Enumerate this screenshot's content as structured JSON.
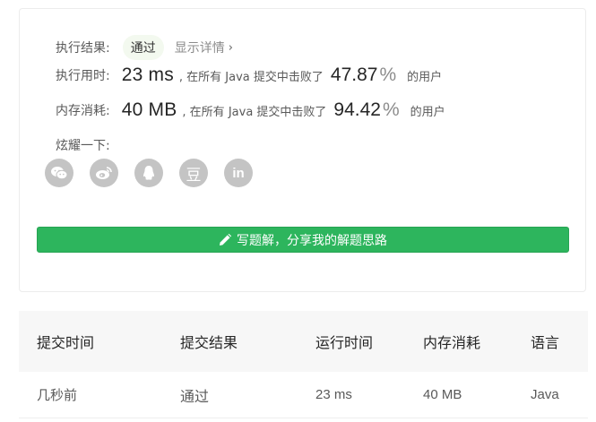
{
  "result": {
    "label": "执行结果:",
    "status": "通过",
    "detail_link": "显示详情",
    "detail_chevron": "›"
  },
  "runtime": {
    "label": "执行用时:",
    "value": "23 ms",
    "prefix": ", 在所有 Java 提交中击败了",
    "percent": "47.87",
    "percent_sign": "%",
    "suffix": "的用户"
  },
  "memory": {
    "label": "内存消耗:",
    "value": "40 MB",
    "prefix": ", 在所有 Java 提交中击败了",
    "percent": "94.42",
    "percent_sign": "%",
    "suffix": "的用户"
  },
  "share": {
    "title": "炫耀一下:",
    "icons": [
      "wechat-icon",
      "weibo-icon",
      "qq-icon",
      "douban-icon",
      "linkedin-icon"
    ],
    "douban_glyph": "豆",
    "linkedin_glyph": "in"
  },
  "solution_button": {
    "label": "写题解，分享我的解题思路"
  },
  "submissions": {
    "headers": [
      "提交时间",
      "提交结果",
      "运行时间",
      "内存消耗",
      "语言"
    ],
    "rows": [
      [
        "几秒前",
        "通过",
        "23 ms",
        "40 MB",
        "Java"
      ]
    ]
  },
  "colors": {
    "accent_green": "#2db55d",
    "pass_green": "#5cb85c",
    "icon_gray": "#c4c4c4"
  }
}
